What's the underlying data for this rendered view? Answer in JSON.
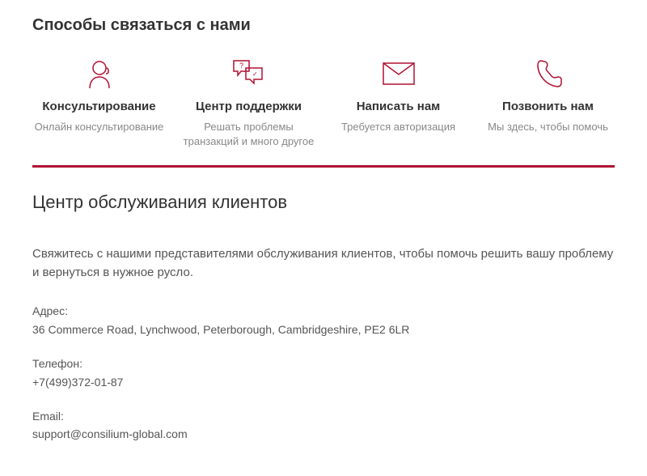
{
  "main_title": "Способы связаться с нами",
  "options": [
    {
      "title": "Консультирование",
      "subtitle": "Онлайн консультирование"
    },
    {
      "title": "Центр поддержки",
      "subtitle": "Решать проблемы транзакций и много другое"
    },
    {
      "title": "Написать нам",
      "subtitle": "Требуется авторизация"
    },
    {
      "title": "Позвонить нам",
      "subtitle": "Мы здесь, чтобы помочь"
    }
  ],
  "section_title": "Центр обслуживания клиентов",
  "description": "Свяжитесь с нашими представителями обслуживания клиентов, чтобы помочь решить вашу проблему и вернуться в нужное русло.",
  "address_label": "Адрес:",
  "address_value": "36 Commerce Road, Lynchwood, Peterborough, Cambridgeshire, PE2 6LR",
  "phone_label": "Телефон:",
  "phone_value": "+7(499)372-01-87",
  "email_label": "Email:",
  "email_value": "support@consilium-global.com"
}
